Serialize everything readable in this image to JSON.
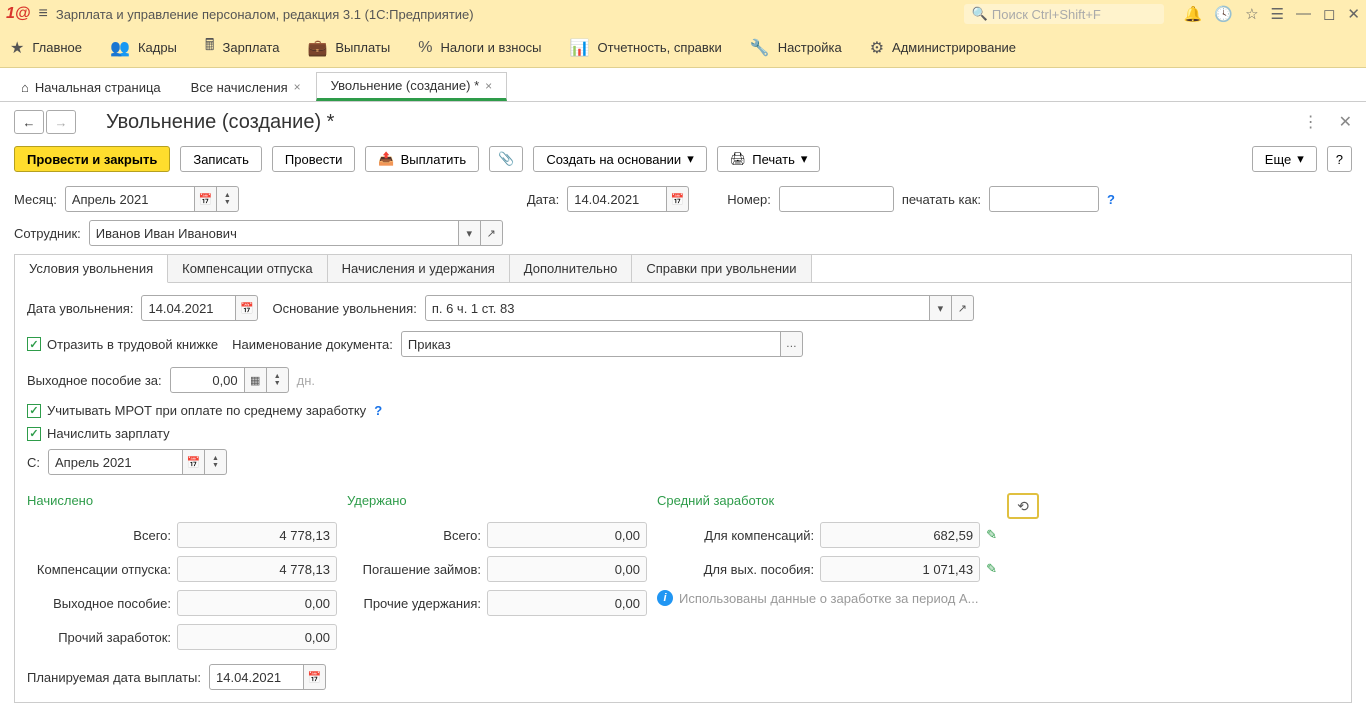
{
  "app": {
    "title": "Зарплата и управление персоналом, редакция 3.1  (1С:Предприятие)",
    "search_placeholder": "Поиск Ctrl+Shift+F"
  },
  "mainmenu": {
    "items": [
      {
        "icon": "star",
        "label": "Главное"
      },
      {
        "icon": "people",
        "label": "Кадры"
      },
      {
        "icon": "calc",
        "label": "Зарплата"
      },
      {
        "icon": "wallet",
        "label": "Выплаты"
      },
      {
        "icon": "percent",
        "label": "Налоги и взносы"
      },
      {
        "icon": "report",
        "label": "Отчетность, справки"
      },
      {
        "icon": "wrench",
        "label": "Настройка"
      },
      {
        "icon": "gear",
        "label": "Администрирование"
      }
    ]
  },
  "tabs": {
    "home": "Начальная страница",
    "t1": "Все начисления",
    "t2": "Увольнение (создание) *"
  },
  "page": {
    "title": "Увольнение (создание) *"
  },
  "toolbar": {
    "post_close": "Провести и закрыть",
    "save": "Записать",
    "post": "Провести",
    "pay": "Выплатить",
    "create_based": "Создать на основании",
    "print": "Печать",
    "more": "Еще"
  },
  "header_fields": {
    "month_lbl": "Месяц:",
    "month_val": "Апрель 2021",
    "date_lbl": "Дата:",
    "date_val": "14.04.2021",
    "number_lbl": "Номер:",
    "number_val": "",
    "printas_lbl": "печатать как:",
    "printas_val": "",
    "employee_lbl": "Сотрудник:",
    "employee_val": "Иванов Иван Иванович"
  },
  "inner_tabs": {
    "t0": "Условия увольнения",
    "t1": "Компенсации отпуска",
    "t2": "Начисления и удержания",
    "t3": "Дополнительно",
    "t4": "Справки при увольнении"
  },
  "conditions": {
    "dismiss_date_lbl": "Дата увольнения:",
    "dismiss_date_val": "14.04.2021",
    "basis_lbl": "Основание увольнения:",
    "basis_val": "п. 6 ч. 1 ст. 83",
    "reflect_lbl": "Отразить в трудовой книжке",
    "docname_lbl": "Наименование документа:",
    "docname_val": "Приказ",
    "severance_lbl": "Выходное пособие за:",
    "severance_val": "0,00",
    "severance_unit": "дн.",
    "mrot_lbl": "Учитывать МРОТ при оплате по среднему заработку",
    "accrue_lbl": "Начислить зарплату",
    "from_lbl": "С:",
    "from_val": "Апрель 2021"
  },
  "totals": {
    "accrued_h": "Начислено",
    "withheld_h": "Удержано",
    "avg_h": "Средний заработок",
    "rows_acc": {
      "total_lbl": "Всего:",
      "total_val": "4 778,13",
      "comp_lbl": "Компенсации отпуска:",
      "comp_val": "4 778,13",
      "sever_lbl": "Выходное пособие:",
      "sever_val": "0,00",
      "other_lbl": "Прочий заработок:",
      "other_val": "0,00"
    },
    "rows_wh": {
      "total_lbl": "Всего:",
      "total_val": "0,00",
      "loan_lbl": "Погашение займов:",
      "loan_val": "0,00",
      "other_lbl": "Прочие удержания:",
      "other_val": "0,00"
    },
    "rows_avg": {
      "comp_lbl": "Для компенсаций:",
      "comp_val": "682,59",
      "sever_lbl": "Для вых. пособия:",
      "sever_val": "1 071,43",
      "note": "Использованы данные о заработке за период А..."
    },
    "planned_lbl": "Планируемая дата выплаты:",
    "planned_val": "14.04.2021"
  }
}
